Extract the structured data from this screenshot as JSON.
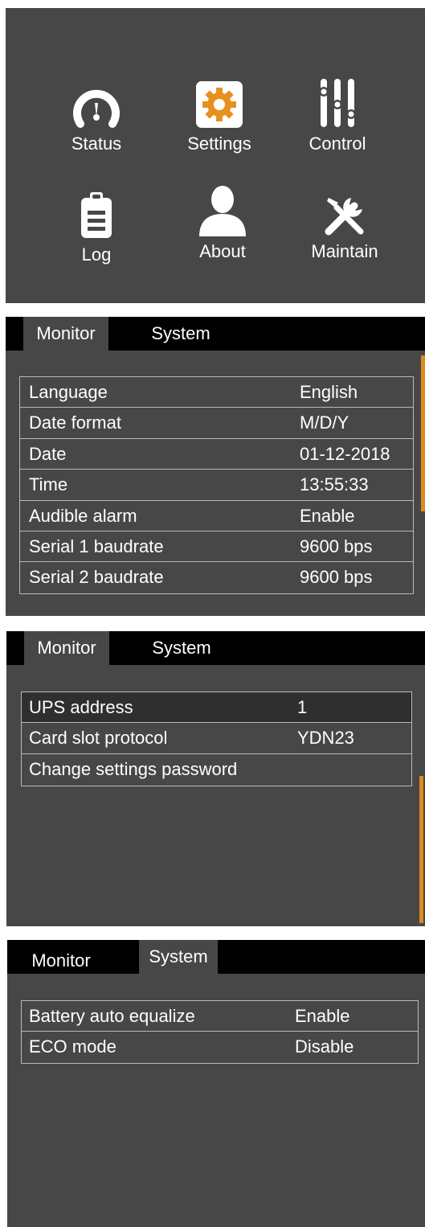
{
  "menu": {
    "items": [
      {
        "label": "Status",
        "icon": "gauge-icon"
      },
      {
        "label": "Settings",
        "icon": "gear-icon"
      },
      {
        "label": "Control",
        "icon": "sliders-icon"
      },
      {
        "label": "Log",
        "icon": "clipboard-icon"
      },
      {
        "label": "About",
        "icon": "user-icon"
      },
      {
        "label": "Maintain",
        "icon": "tools-icon"
      }
    ],
    "accent_color": "#e8901f"
  },
  "screens": [
    {
      "tabs": [
        "Monitor",
        "System"
      ],
      "active_tab": "Monitor",
      "rows": [
        {
          "label": "Language",
          "value": "English"
        },
        {
          "label": "Date format",
          "value": "M/D/Y"
        },
        {
          "label": "Date",
          "value": "01-12-2018"
        },
        {
          "label": "Time",
          "value": "13:55:33"
        },
        {
          "label": "Audible alarm",
          "value": "Enable"
        },
        {
          "label": "Serial 1 baudrate",
          "value": "9600 bps"
        },
        {
          "label": "Serial 2 baudrate",
          "value": "9600 bps"
        }
      ]
    },
    {
      "tabs": [
        "Monitor",
        "System"
      ],
      "active_tab": "Monitor",
      "rows": [
        {
          "label": "UPS address",
          "value": "1"
        },
        {
          "label": "Card slot protocol",
          "value": "YDN23"
        },
        {
          "label": "Change settings password",
          "value": ""
        }
      ]
    },
    {
      "tabs": [
        "Monitor",
        "System"
      ],
      "active_tab": "System",
      "rows": [
        {
          "label": "Battery auto equalize",
          "value": "Enable"
        },
        {
          "label": "ECO mode",
          "value": "Disable"
        }
      ]
    }
  ],
  "colors": {
    "panel_bg": "#474747",
    "tabbar_bg": "#000000",
    "scrollbar": "#e08a1e",
    "row_border": "#b9b9b9"
  }
}
